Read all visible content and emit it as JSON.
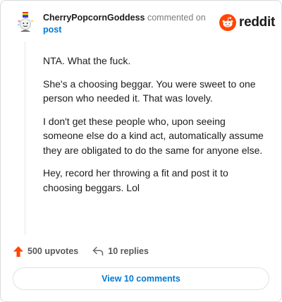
{
  "comment": {
    "username": "CherryPopcornGoddess",
    "meta_text": "commented on",
    "post_link": "post"
  },
  "logo": {
    "text": "reddit",
    "icon": "reddit-alien-icon",
    "brand_color": "#ff4500"
  },
  "body": {
    "paragraphs": [
      "NTA. What the fuck.",
      "She's a choosing beggar. You were sweet to one person who needed it. That was lovely.",
      "I don't get these people who, upon seeing someone else do a kind act, automatically assume they are obligated to do the same for anyone else.",
      "Hey, record her throwing a fit and post it to choosing beggars. Lol"
    ]
  },
  "footer": {
    "upvotes_label": "500 upvotes",
    "replies_label": "10 replies",
    "upvote_color": "#ff4500"
  },
  "actions": {
    "view_comments_label": "View 10 comments"
  },
  "colors": {
    "link": "#0079d3",
    "text": "#1c1c1c",
    "muted": "#7c7c7c"
  }
}
